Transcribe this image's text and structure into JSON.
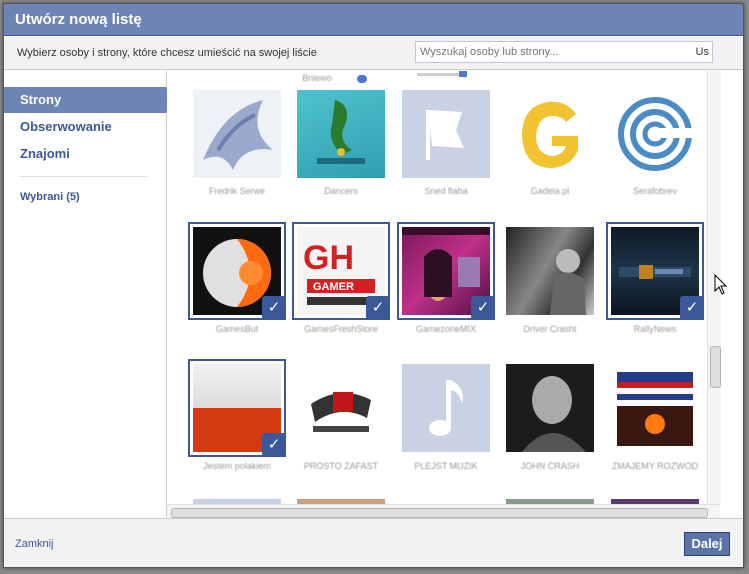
{
  "dialog": {
    "title": "Utwórz nową listę",
    "description": "Wybierz osoby i strony, które chcesz umieścić na swojej liście",
    "search_placeholder": "Wyszukaj osoby lub strony...",
    "search_icon": "Us"
  },
  "sidebar": {
    "items": [
      {
        "label": "Strony",
        "active": true
      },
      {
        "label": "Obserwowanie",
        "active": false
      },
      {
        "label": "Znajomi",
        "active": false
      }
    ],
    "selected_label": "Wybrani (5)"
  },
  "grid": {
    "partial_top_label": "Bnlewo",
    "tiles": [
      {
        "label": "Fredrik Serwe",
        "selected": false,
        "icon": "bird-logo"
      },
      {
        "label": "Dancers",
        "selected": false,
        "icon": "dancer-logo"
      },
      {
        "label": "Sned flaba",
        "selected": false,
        "icon": "flag-placeholder"
      },
      {
        "label": "Gadela.pl",
        "selected": false,
        "icon": "g-letter-logo"
      },
      {
        "label": "Serafobrev",
        "selected": false,
        "icon": "spiral-logo"
      },
      {
        "label": "GamesBut",
        "selected": true,
        "icon": "orange-sphere-logo"
      },
      {
        "label": "GamesFreshStore",
        "selected": true,
        "icon": "gamer-logo"
      },
      {
        "label": "GamezoneMIX",
        "selected": true,
        "icon": "game-cover"
      },
      {
        "label": "Driver Crasht",
        "selected": false,
        "icon": "bw-photo"
      },
      {
        "label": "RallyNews",
        "selected": true,
        "icon": "dark-banner"
      },
      {
        "label": "Jestem polakiem",
        "selected": true,
        "icon": "polish-flag"
      },
      {
        "label": "PROSTO ZAFAST",
        "selected": false,
        "icon": "red-logo"
      },
      {
        "label": "PLEJST MUZIK",
        "selected": false,
        "icon": "music-note"
      },
      {
        "label": "JOHN CRASH",
        "selected": false,
        "icon": "bw-portrait"
      },
      {
        "label": "ZMAJEMY ROZWOD",
        "selected": false,
        "icon": "flag-collage"
      }
    ],
    "check_glyph": "✓"
  },
  "footer": {
    "close_label": "Zamknij",
    "next_label": "Dalej"
  },
  "colors": {
    "brand": "#3b5998",
    "titlebar": "#6d84b4",
    "placeholder_tile": "#c9d1e4"
  }
}
